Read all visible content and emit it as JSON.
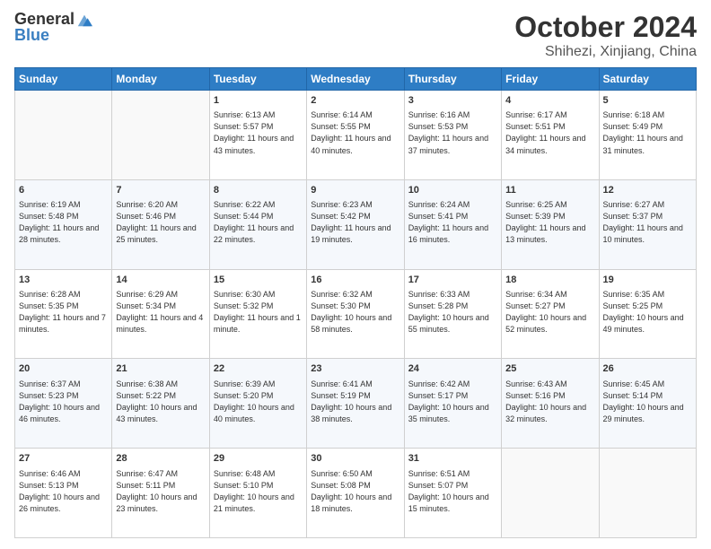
{
  "header": {
    "logo_general": "General",
    "logo_blue": "Blue",
    "title": "October 2024",
    "subtitle": "Shihezi, Xinjiang, China"
  },
  "days_of_week": [
    "Sunday",
    "Monday",
    "Tuesday",
    "Wednesday",
    "Thursday",
    "Friday",
    "Saturday"
  ],
  "weeks": [
    [
      {
        "day": "",
        "info": ""
      },
      {
        "day": "",
        "info": ""
      },
      {
        "day": "1",
        "info": "Sunrise: 6:13 AM\nSunset: 5:57 PM\nDaylight: 11 hours and 43 minutes."
      },
      {
        "day": "2",
        "info": "Sunrise: 6:14 AM\nSunset: 5:55 PM\nDaylight: 11 hours and 40 minutes."
      },
      {
        "day": "3",
        "info": "Sunrise: 6:16 AM\nSunset: 5:53 PM\nDaylight: 11 hours and 37 minutes."
      },
      {
        "day": "4",
        "info": "Sunrise: 6:17 AM\nSunset: 5:51 PM\nDaylight: 11 hours and 34 minutes."
      },
      {
        "day": "5",
        "info": "Sunrise: 6:18 AM\nSunset: 5:49 PM\nDaylight: 11 hours and 31 minutes."
      }
    ],
    [
      {
        "day": "6",
        "info": "Sunrise: 6:19 AM\nSunset: 5:48 PM\nDaylight: 11 hours and 28 minutes."
      },
      {
        "day": "7",
        "info": "Sunrise: 6:20 AM\nSunset: 5:46 PM\nDaylight: 11 hours and 25 minutes."
      },
      {
        "day": "8",
        "info": "Sunrise: 6:22 AM\nSunset: 5:44 PM\nDaylight: 11 hours and 22 minutes."
      },
      {
        "day": "9",
        "info": "Sunrise: 6:23 AM\nSunset: 5:42 PM\nDaylight: 11 hours and 19 minutes."
      },
      {
        "day": "10",
        "info": "Sunrise: 6:24 AM\nSunset: 5:41 PM\nDaylight: 11 hours and 16 minutes."
      },
      {
        "day": "11",
        "info": "Sunrise: 6:25 AM\nSunset: 5:39 PM\nDaylight: 11 hours and 13 minutes."
      },
      {
        "day": "12",
        "info": "Sunrise: 6:27 AM\nSunset: 5:37 PM\nDaylight: 11 hours and 10 minutes."
      }
    ],
    [
      {
        "day": "13",
        "info": "Sunrise: 6:28 AM\nSunset: 5:35 PM\nDaylight: 11 hours and 7 minutes."
      },
      {
        "day": "14",
        "info": "Sunrise: 6:29 AM\nSunset: 5:34 PM\nDaylight: 11 hours and 4 minutes."
      },
      {
        "day": "15",
        "info": "Sunrise: 6:30 AM\nSunset: 5:32 PM\nDaylight: 11 hours and 1 minute."
      },
      {
        "day": "16",
        "info": "Sunrise: 6:32 AM\nSunset: 5:30 PM\nDaylight: 10 hours and 58 minutes."
      },
      {
        "day": "17",
        "info": "Sunrise: 6:33 AM\nSunset: 5:28 PM\nDaylight: 10 hours and 55 minutes."
      },
      {
        "day": "18",
        "info": "Sunrise: 6:34 AM\nSunset: 5:27 PM\nDaylight: 10 hours and 52 minutes."
      },
      {
        "day": "19",
        "info": "Sunrise: 6:35 AM\nSunset: 5:25 PM\nDaylight: 10 hours and 49 minutes."
      }
    ],
    [
      {
        "day": "20",
        "info": "Sunrise: 6:37 AM\nSunset: 5:23 PM\nDaylight: 10 hours and 46 minutes."
      },
      {
        "day": "21",
        "info": "Sunrise: 6:38 AM\nSunset: 5:22 PM\nDaylight: 10 hours and 43 minutes."
      },
      {
        "day": "22",
        "info": "Sunrise: 6:39 AM\nSunset: 5:20 PM\nDaylight: 10 hours and 40 minutes."
      },
      {
        "day": "23",
        "info": "Sunrise: 6:41 AM\nSunset: 5:19 PM\nDaylight: 10 hours and 38 minutes."
      },
      {
        "day": "24",
        "info": "Sunrise: 6:42 AM\nSunset: 5:17 PM\nDaylight: 10 hours and 35 minutes."
      },
      {
        "day": "25",
        "info": "Sunrise: 6:43 AM\nSunset: 5:16 PM\nDaylight: 10 hours and 32 minutes."
      },
      {
        "day": "26",
        "info": "Sunrise: 6:45 AM\nSunset: 5:14 PM\nDaylight: 10 hours and 29 minutes."
      }
    ],
    [
      {
        "day": "27",
        "info": "Sunrise: 6:46 AM\nSunset: 5:13 PM\nDaylight: 10 hours and 26 minutes."
      },
      {
        "day": "28",
        "info": "Sunrise: 6:47 AM\nSunset: 5:11 PM\nDaylight: 10 hours and 23 minutes."
      },
      {
        "day": "29",
        "info": "Sunrise: 6:48 AM\nSunset: 5:10 PM\nDaylight: 10 hours and 21 minutes."
      },
      {
        "day": "30",
        "info": "Sunrise: 6:50 AM\nSunset: 5:08 PM\nDaylight: 10 hours and 18 minutes."
      },
      {
        "day": "31",
        "info": "Sunrise: 6:51 AM\nSunset: 5:07 PM\nDaylight: 10 hours and 15 minutes."
      },
      {
        "day": "",
        "info": ""
      },
      {
        "day": "",
        "info": ""
      }
    ]
  ]
}
